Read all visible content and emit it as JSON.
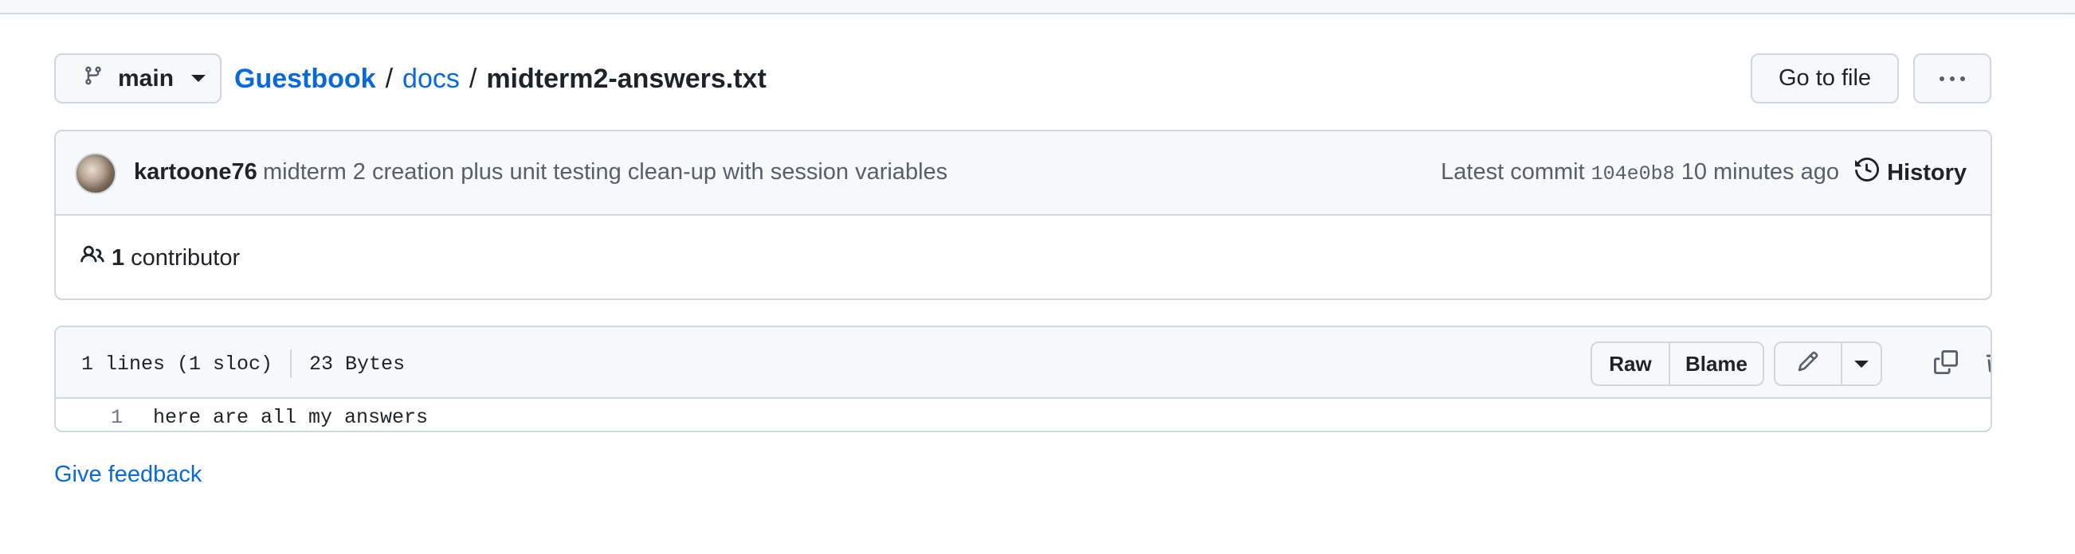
{
  "branch": {
    "name": "main"
  },
  "breadcrumb": {
    "repo": "Guestbook",
    "folder": "docs",
    "file": "midterm2-answers.txt",
    "separator": "/"
  },
  "header": {
    "goto_file_label": "Go to file"
  },
  "commit": {
    "author": "kartoone76",
    "message": "midterm 2 creation plus unit testing clean-up with session variables",
    "latest_label": "Latest commit",
    "sha": "104e0b8",
    "time_ago": "10 minutes ago",
    "history_label": "History"
  },
  "contributors": {
    "count": "1",
    "label": "contributor"
  },
  "file": {
    "lines_info": "1 lines (1 sloc)",
    "size": "23 Bytes",
    "raw_label": "Raw",
    "blame_label": "Blame",
    "lines": [
      {
        "number": "1",
        "code": "here are all my answers"
      }
    ]
  },
  "footer": {
    "feedback_label": "Give feedback"
  },
  "colors": {
    "link": "#0969da",
    "border": "#d0d7de",
    "muted": "#57606a",
    "subtle_bg": "#f6f8fa"
  }
}
